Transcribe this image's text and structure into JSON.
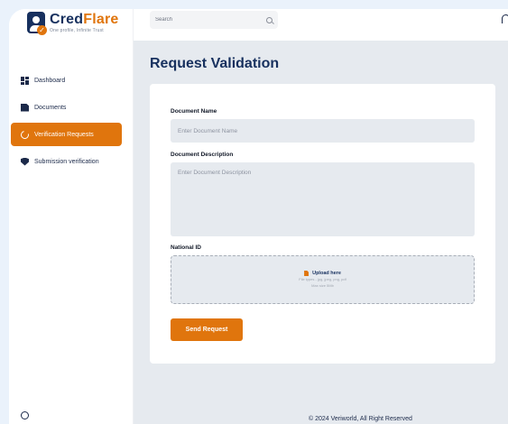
{
  "brand": {
    "name_part1": "Cred",
    "name_part2": "Flare",
    "tagline": "One profile, Infinite Trust",
    "colors": {
      "navy": "#17305e",
      "orange": "#e0750d"
    }
  },
  "sidebar": {
    "items": [
      {
        "label": "Dashboard",
        "icon": "grid-icon",
        "active": false
      },
      {
        "label": "Documents",
        "icon": "document-icon",
        "active": false
      },
      {
        "label": "Verification Requests",
        "icon": "progress-ring-icon",
        "active": true
      },
      {
        "label": "Submission verification",
        "icon": "shield-check-icon",
        "active": false
      }
    ]
  },
  "topbar": {
    "search_placeholder": "Search",
    "notification_icon": "bell-icon"
  },
  "page": {
    "title": "Request Validation"
  },
  "form": {
    "document_name_label": "Document Name",
    "document_name_placeholder": "Enter Document Name",
    "document_description_label": "Document Description",
    "document_description_placeholder": "Enter Document Description",
    "national_id_label": "National ID",
    "upload_title": "Upload here",
    "upload_file_types": "File types - jpg, jpeg, png, pdf",
    "upload_max_size": "Max size 5Mb",
    "submit_label": "Send Request"
  },
  "footer": {
    "text": "© 2024 Veriworld, All Right Reserved"
  }
}
